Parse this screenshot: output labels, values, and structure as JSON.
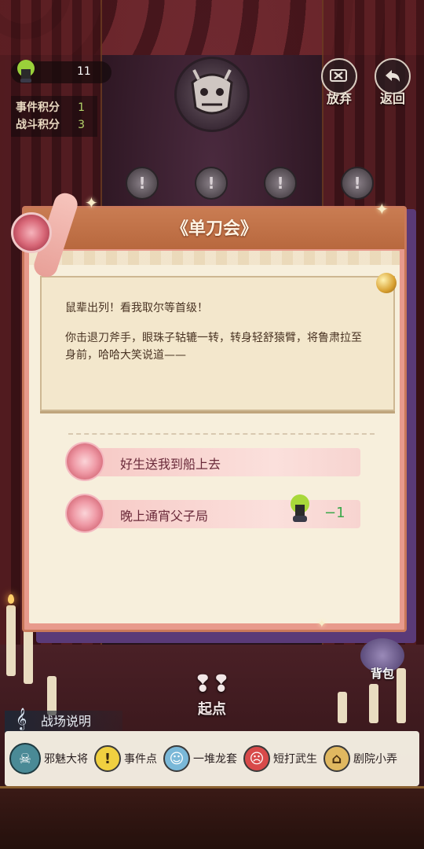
{
  "hud": {
    "count": "11",
    "event_score_label": "事件积分",
    "event_score_value": "1",
    "battle_score_label": "战斗积分",
    "battle_score_value": "3"
  },
  "buttons": {
    "give_up": "放弃",
    "back": "返回"
  },
  "nodes": [
    "!",
    "!",
    "!",
    "!"
  ],
  "dialog": {
    "title": "《单刀会》",
    "paragraphs": [
      "鼠辈出列！看我取尔等首级！",
      "你击退刀斧手，眼珠子轱辘一转，转身轻舒猿臂，将鲁肃拉至身前，哈哈大笑说道——"
    ],
    "choices": [
      {
        "label": "好生送我到船上去"
      },
      {
        "label": "晚上通宵父子局",
        "cost": "−1"
      }
    ]
  },
  "start_label": "起点",
  "backpack_label": "背包",
  "legend": {
    "title": "战场说明",
    "items": [
      {
        "label": "邪魅大将",
        "icon": "demon-general-icon"
      },
      {
        "label": "事件点",
        "icon": "event-point-icon"
      },
      {
        "label": "一堆龙套",
        "icon": "minions-icon"
      },
      {
        "label": "短打武生",
        "icon": "martial-actor-icon"
      },
      {
        "label": "剧院小弄",
        "icon": "theater-alley-icon"
      }
    ]
  },
  "colors": {
    "dialog_border": "#c9785a",
    "dialog_title_bg": "#b8683e",
    "paper": "#f7efdc",
    "choice_text": "#6a2a3a",
    "cost_green": "#3aa84a"
  }
}
